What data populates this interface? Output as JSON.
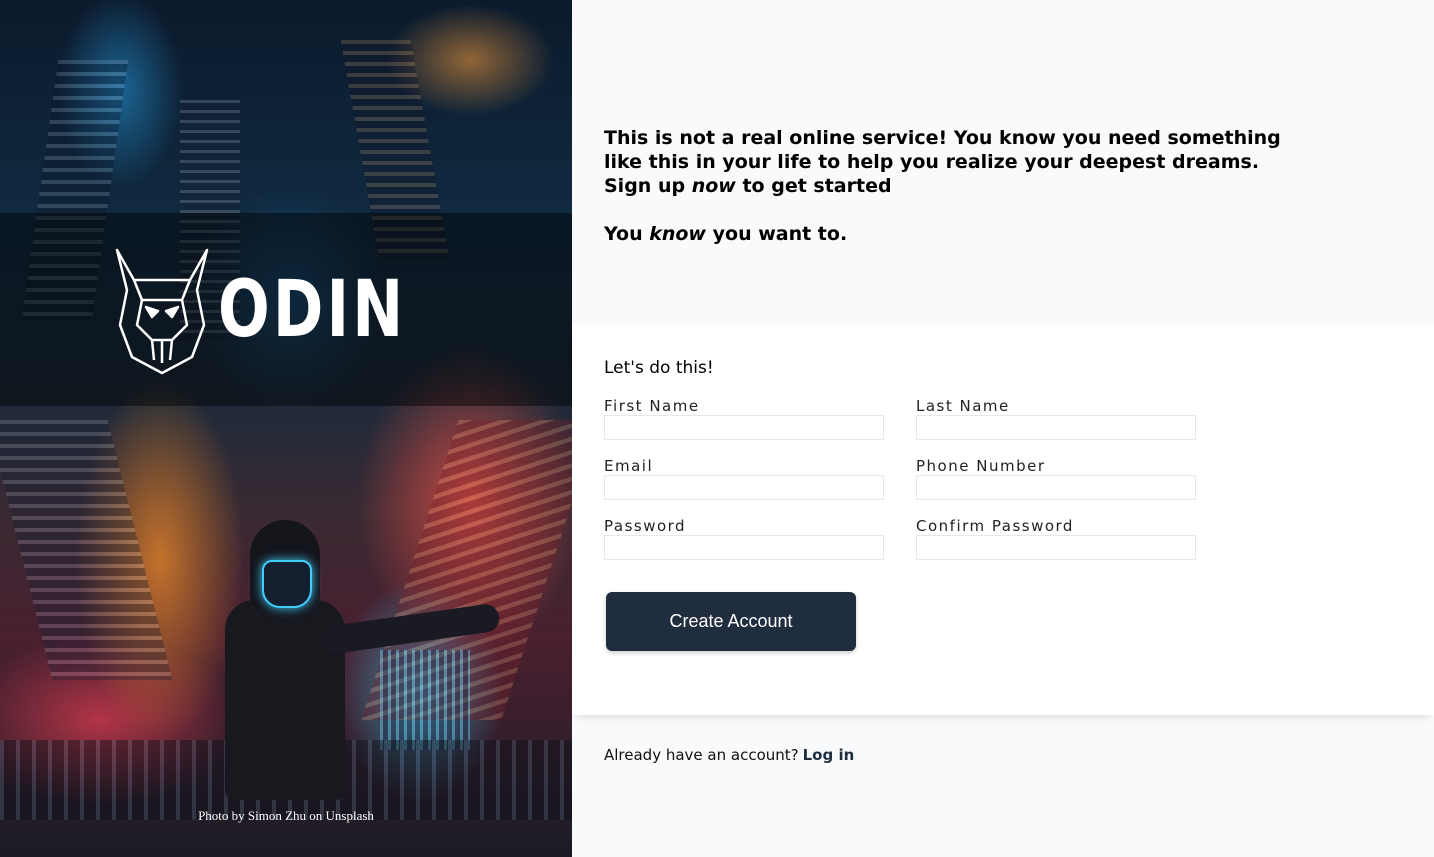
{
  "side": {
    "logo_text": "ODIN",
    "photo_credit": "Photo by Simon Zhu on Unsplash"
  },
  "intro": {
    "line1": "This is not a real online service! You know you need something like this in your life to help you realize your deepest dreams.",
    "line2_pre": "Sign up",
    "line2_em": "now",
    "line2_post": "to get started",
    "line3_pre": "You",
    "line3_em": "know",
    "line3_post": "you want to."
  },
  "form": {
    "title": "Let's do this!",
    "fields": [
      {
        "label": "First Name",
        "value": ""
      },
      {
        "label": "Last Name",
        "value": ""
      },
      {
        "label": "Email",
        "value": ""
      },
      {
        "label": "Phone Number",
        "value": ""
      },
      {
        "label": "Password",
        "value": ""
      },
      {
        "label": "Confirm Password",
        "value": ""
      }
    ],
    "submit_label": "Create Account"
  },
  "footer": {
    "prompt": "Already have an account?",
    "login_label": "Log in"
  },
  "colors": {
    "accent": "#1f2d3f",
    "page_bg": "#f9fafb",
    "card_bg": "#ffffff",
    "input_border": "#e5e7eb",
    "mask_glow": "#3fd0ff"
  },
  "icons": {
    "logo": "viking-helmet-icon"
  }
}
